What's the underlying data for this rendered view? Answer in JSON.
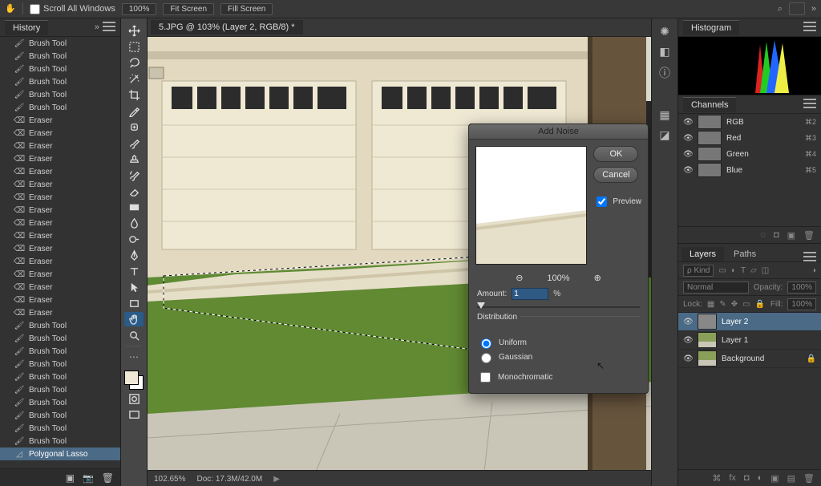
{
  "optbar": {
    "scroll_all": "Scroll All Windows",
    "zoom": "100%",
    "fit_screen": "Fit Screen",
    "fill_screen": "Fill Screen"
  },
  "history": {
    "title": "History",
    "items": [
      {
        "label": "Brush Tool",
        "icon": "brush"
      },
      {
        "label": "Brush Tool",
        "icon": "brush"
      },
      {
        "label": "Brush Tool",
        "icon": "brush"
      },
      {
        "label": "Brush Tool",
        "icon": "brush"
      },
      {
        "label": "Brush Tool",
        "icon": "brush"
      },
      {
        "label": "Brush Tool",
        "icon": "brush"
      },
      {
        "label": "Eraser",
        "icon": "eraser"
      },
      {
        "label": "Eraser",
        "icon": "eraser"
      },
      {
        "label": "Eraser",
        "icon": "eraser"
      },
      {
        "label": "Eraser",
        "icon": "eraser"
      },
      {
        "label": "Eraser",
        "icon": "eraser"
      },
      {
        "label": "Eraser",
        "icon": "eraser"
      },
      {
        "label": "Eraser",
        "icon": "eraser"
      },
      {
        "label": "Eraser",
        "icon": "eraser"
      },
      {
        "label": "Eraser",
        "icon": "eraser"
      },
      {
        "label": "Eraser",
        "icon": "eraser"
      },
      {
        "label": "Eraser",
        "icon": "eraser"
      },
      {
        "label": "Eraser",
        "icon": "eraser"
      },
      {
        "label": "Eraser",
        "icon": "eraser"
      },
      {
        "label": "Eraser",
        "icon": "eraser"
      },
      {
        "label": "Eraser",
        "icon": "eraser"
      },
      {
        "label": "Eraser",
        "icon": "eraser"
      },
      {
        "label": "Brush Tool",
        "icon": "brush"
      },
      {
        "label": "Brush Tool",
        "icon": "brush"
      },
      {
        "label": "Brush Tool",
        "icon": "brush"
      },
      {
        "label": "Brush Tool",
        "icon": "brush"
      },
      {
        "label": "Brush Tool",
        "icon": "brush"
      },
      {
        "label": "Brush Tool",
        "icon": "brush"
      },
      {
        "label": "Brush Tool",
        "icon": "brush"
      },
      {
        "label": "Brush Tool",
        "icon": "brush"
      },
      {
        "label": "Brush Tool",
        "icon": "brush"
      },
      {
        "label": "Brush Tool",
        "icon": "brush"
      },
      {
        "label": "Polygonal Lasso",
        "icon": "lasso"
      }
    ]
  },
  "doc": {
    "tab": "5.JPG @ 103% (Layer 2, RGB/8) *"
  },
  "status": {
    "zoom": "102.65%",
    "doc": "Doc: 17.3M/42.0M"
  },
  "dialog": {
    "title": "Add Noise",
    "ok": "OK",
    "cancel": "Cancel",
    "preview": "Preview",
    "preview_zoom": "100%",
    "amount_label": "Amount:",
    "amount_value": "1",
    "amount_unit": "%",
    "distribution": "Distribution",
    "uniform": "Uniform",
    "gaussian": "Gaussian",
    "mono": "Monochromatic"
  },
  "panels": {
    "histogram": "Histogram",
    "channels": "Channels",
    "layers": "Layers",
    "paths": "Paths"
  },
  "channels": [
    {
      "name": "RGB",
      "sc": "⌘2"
    },
    {
      "name": "Red",
      "sc": "⌘3"
    },
    {
      "name": "Green",
      "sc": "⌘4"
    },
    {
      "name": "Blue",
      "sc": "⌘5"
    }
  ],
  "layersPanel": {
    "kind": "ρ Kind",
    "blend": "Normal",
    "opacity_label": "Opacity:",
    "opacity": "100%",
    "lock": "Lock:",
    "fill_label": "Fill:",
    "fill": "100%",
    "layers": [
      {
        "name": "Layer 2",
        "sel": true,
        "lock": false
      },
      {
        "name": "Layer 1",
        "sel": false,
        "lock": false
      },
      {
        "name": "Background",
        "sel": false,
        "lock": true
      }
    ]
  }
}
